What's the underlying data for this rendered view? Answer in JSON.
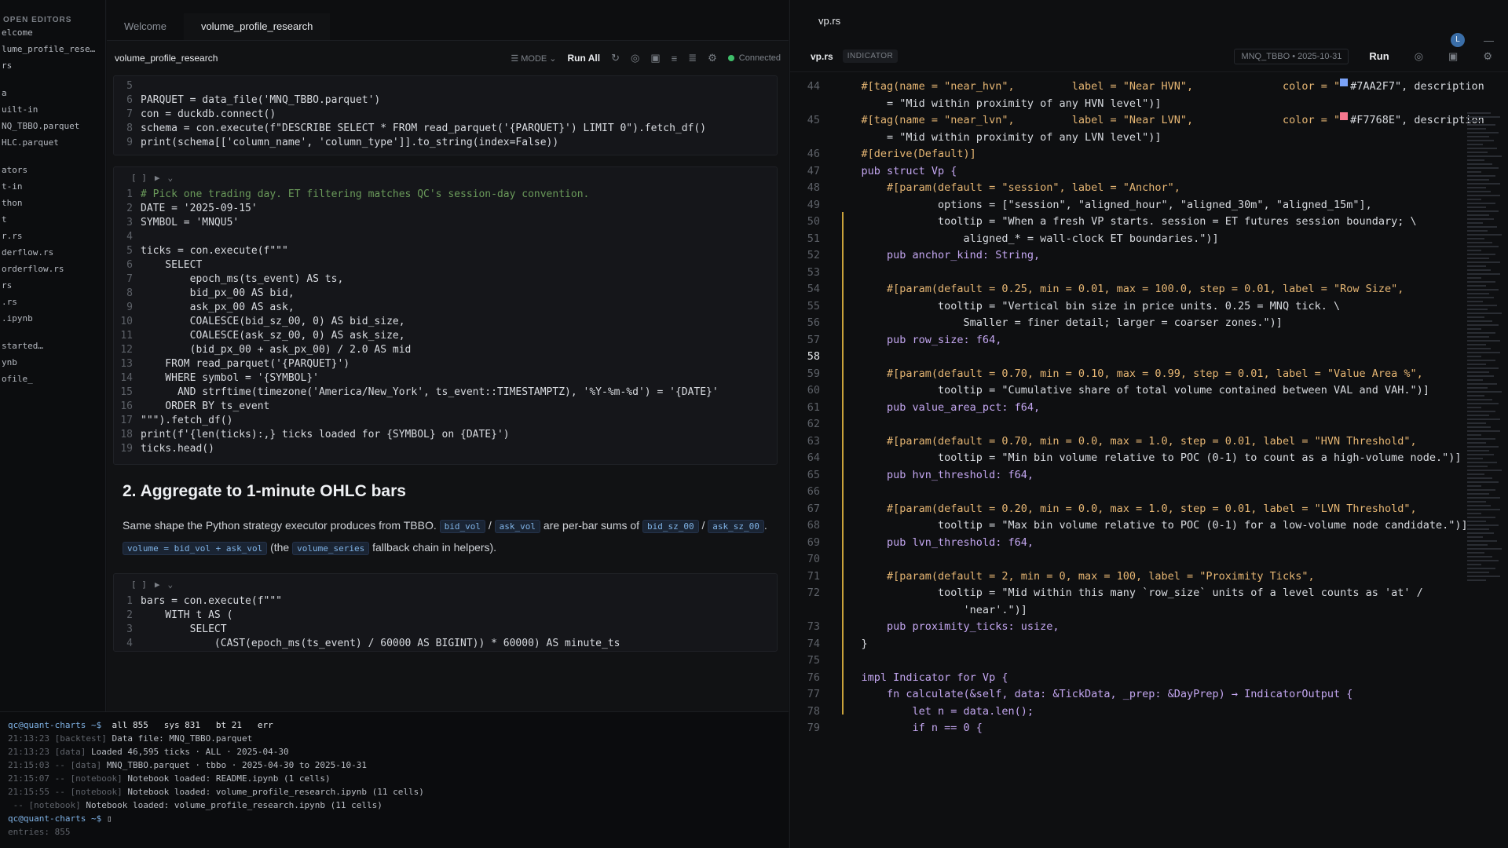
{
  "explorer": {
    "section": "OPEN EDITORS",
    "items": [
      "elcome",
      "lume_profile_rese…",
      "rs",
      "a",
      "uilt-in",
      "NQ_TBBO.parquet",
      "HLC.parquet",
      "ators",
      "t-in",
      "thon",
      "t",
      "r.rs",
      "derflow.rs",
      "orderflow.rs",
      "rs",
      ".rs",
      ".ipynb",
      "started…",
      "ynb",
      "ofile_"
    ]
  },
  "notebook": {
    "tabs": [
      "Welcome",
      "volume_profile_research"
    ],
    "title": "volume_profile_research",
    "mode_label": "MODE",
    "run_all": "Run All",
    "status": "Connected",
    "cell1_lines": [
      {
        "n": "5",
        "code": ""
      },
      {
        "n": "6",
        "code": "PARQUET = data_file('MNQ_TBBO.parquet')"
      },
      {
        "n": "7",
        "code": "con = duckdb.connect()"
      },
      {
        "n": "8",
        "code": "schema = con.execute(f\"DESCRIBE SELECT * FROM read_parquet('{PARQUET}') LIMIT 0\").fetch_df()"
      },
      {
        "n": "9",
        "code": "print(schema[['column_name', 'column_type']].to_string(index=False))"
      }
    ],
    "cell2_lines": [
      {
        "n": "1",
        "code": "# Pick one trading day. ET filtering matches QC's session-day convention."
      },
      {
        "n": "2",
        "code": "DATE = '2025-09-15'"
      },
      {
        "n": "3",
        "code": "SYMBOL = 'MNQU5'"
      },
      {
        "n": "4",
        "code": ""
      },
      {
        "n": "5",
        "code": "ticks = con.execute(f\"\"\""
      },
      {
        "n": "6",
        "code": "    SELECT"
      },
      {
        "n": "7",
        "code": "        epoch_ms(ts_event) AS ts,"
      },
      {
        "n": "8",
        "code": "        bid_px_00 AS bid,"
      },
      {
        "n": "9",
        "code": "        ask_px_00 AS ask,"
      },
      {
        "n": "10",
        "code": "        COALESCE(bid_sz_00, 0) AS bid_size,"
      },
      {
        "n": "11",
        "code": "        COALESCE(ask_sz_00, 0) AS ask_size,"
      },
      {
        "n": "12",
        "code": "        (bid_px_00 + ask_px_00) / 2.0 AS mid"
      },
      {
        "n": "13",
        "code": "    FROM read_parquet('{PARQUET}')"
      },
      {
        "n": "14",
        "code": "    WHERE symbol = '{SYMBOL}'"
      },
      {
        "n": "15",
        "code": "      AND strftime(timezone('America/New_York', ts_event::TIMESTAMPTZ), '%Y-%m-%d') = '{DATE}'"
      },
      {
        "n": "16",
        "code": "    ORDER BY ts_event"
      },
      {
        "n": "17",
        "code": "\"\"\").fetch_df()"
      },
      {
        "n": "18",
        "code": "print(f'{len(ticks):,} ticks loaded for {SYMBOL} on {DATE}')"
      },
      {
        "n": "19",
        "code": "ticks.head()"
      }
    ],
    "md_heading": "2. Aggregate to 1-minute OHLC bars",
    "md_text_1": "Same shape the Python strategy executor produces from TBBO.",
    "md_chip_1": "bid_vol",
    "md_sep_1": "/",
    "md_chip_2": "ask_vol",
    "md_text_2": "are per-bar sums of",
    "md_chip_3": "bid_sz_00",
    "md_sep_2": "/",
    "md_chip_4": "ask_sz_00",
    "md_sep_3": ".",
    "md_chip_5": "volume = bid_vol + ask_vol",
    "md_text_3": "(the",
    "md_chip_6": "volume_series",
    "md_text_4": "fallback chain in helpers).",
    "cell3_lines": [
      {
        "n": "1",
        "code": "bars = con.execute(f\"\"\""
      },
      {
        "n": "2",
        "code": "    WITH t AS ("
      },
      {
        "n": "3",
        "code": "        SELECT"
      },
      {
        "n": "4",
        "code": "            (CAST(epoch_ms(ts_event) / 60000 AS BIGINT)) * 60000) AS minute_ts"
      }
    ]
  },
  "terminal": {
    "prompt": "qc@quant-charts ~$",
    "counters": "all 855   sys 831   bt 21   err",
    "lines": [
      {
        "time": "21:13:23",
        "tag": "[backtest]",
        "text": "Data file: MNQ_TBBO.parquet"
      },
      {
        "time": "21:13:23",
        "tag": "[data]",
        "text": "Loaded 46,595 ticks · ALL · 2025-04-30"
      },
      {
        "time": "21:15:03",
        "tag": "-- [data]",
        "text": "MNQ_TBBO.parquet · tbbo · 2025-04-30 to 2025-10-31"
      },
      {
        "time": "21:15:07",
        "tag": "-- [notebook]",
        "text": "Notebook loaded: README.ipynb (1 cells)"
      },
      {
        "time": "21:15:55",
        "tag": "-- [notebook]",
        "text": "Notebook loaded: volume_profile_research.ipynb (11 cells)"
      },
      {
        "time": "",
        "tag": "-- [notebook]",
        "text": "Notebook loaded: volume_profile_research.ipynb (11 cells)"
      }
    ],
    "footer": "entries: 855"
  },
  "editor": {
    "file": "vp.rs",
    "tab": "vp.rs",
    "badge": "INDICATOR",
    "context": "MNQ_TBBO • 2025-10-31",
    "run": "Run",
    "avatar": "L",
    "active_line": "58",
    "lines": [
      {
        "n": "44",
        "code": "    #[tag(name = \"near_hvn\",         label = \"Near HVN\",              color = \"",
        "swatch": "#7AA2F7",
        "tail": "#7AA2F7\", description"
      },
      {
        "n": "",
        "code": "        = \"Mid within proximity of any HVN level\")]",
        "swatch": "",
        "tail": ""
      },
      {
        "n": "45",
        "code": "    #[tag(name = \"near_lvn\",         label = \"Near LVN\",              color = \"",
        "swatch": "#F7768E",
        "tail": "#F7768E\", description"
      },
      {
        "n": "",
        "code": "        = \"Mid within proximity of any LVN level\")]",
        "swatch": "",
        "tail": ""
      },
      {
        "n": "46",
        "code": "    #[derive(Default)]",
        "swatch": "",
        "tail": ""
      },
      {
        "n": "47",
        "code": "    pub struct Vp {",
        "swatch": "",
        "tail": ""
      },
      {
        "n": "48",
        "code": "        #[param(default = \"session\", label = \"Anchor\",",
        "swatch": "",
        "tail": ""
      },
      {
        "n": "49",
        "code": "                options = [\"session\", \"aligned_hour\", \"aligned_30m\", \"aligned_15m\"],",
        "swatch": "",
        "tail": ""
      },
      {
        "n": "50",
        "code": "                tooltip = \"When a fresh VP starts. session = ET futures session boundary; \\",
        "swatch": "",
        "tail": ""
      },
      {
        "n": "51",
        "code": "                    aligned_* = wall-clock ET boundaries.\")]",
        "swatch": "",
        "tail": ""
      },
      {
        "n": "52",
        "code": "        pub anchor_kind: String,",
        "swatch": "",
        "tail": ""
      },
      {
        "n": "53",
        "code": "",
        "swatch": "",
        "tail": ""
      },
      {
        "n": "54",
        "code": "        #[param(default = 0.25, min = 0.01, max = 100.0, step = 0.01, label = \"Row Size\",",
        "swatch": "",
        "tail": ""
      },
      {
        "n": "55",
        "code": "                tooltip = \"Vertical bin size in price units. 0.25 = MNQ tick. \\",
        "swatch": "",
        "tail": ""
      },
      {
        "n": "56",
        "code": "                    Smaller = finer detail; larger = coarser zones.\")]",
        "swatch": "",
        "tail": ""
      },
      {
        "n": "57",
        "code": "        pub row_size: f64,",
        "swatch": "",
        "tail": ""
      },
      {
        "n": "58",
        "code": "",
        "swatch": "",
        "tail": ""
      },
      {
        "n": "59",
        "code": "        #[param(default = 0.70, min = 0.10, max = 0.99, step = 0.01, label = \"Value Area %\",",
        "swatch": "",
        "tail": ""
      },
      {
        "n": "60",
        "code": "                tooltip = \"Cumulative share of total volume contained between VAL and VAH.\")]",
        "swatch": "",
        "tail": ""
      },
      {
        "n": "61",
        "code": "        pub value_area_pct: f64,",
        "swatch": "",
        "tail": ""
      },
      {
        "n": "62",
        "code": "",
        "swatch": "",
        "tail": ""
      },
      {
        "n": "63",
        "code": "        #[param(default = 0.70, min = 0.0, max = 1.0, step = 0.01, label = \"HVN Threshold\",",
        "swatch": "",
        "tail": ""
      },
      {
        "n": "64",
        "code": "                tooltip = \"Min bin volume relative to POC (0-1) to count as a high-volume node.\")]",
        "swatch": "",
        "tail": ""
      },
      {
        "n": "65",
        "code": "        pub hvn_threshold: f64,",
        "swatch": "",
        "tail": ""
      },
      {
        "n": "66",
        "code": "",
        "swatch": "",
        "tail": ""
      },
      {
        "n": "67",
        "code": "        #[param(default = 0.20, min = 0.0, max = 1.0, step = 0.01, label = \"LVN Threshold\",",
        "swatch": "",
        "tail": ""
      },
      {
        "n": "68",
        "code": "                tooltip = \"Max bin volume relative to POC (0-1) for a low-volume node candidate.\")]",
        "swatch": "",
        "tail": ""
      },
      {
        "n": "69",
        "code": "        pub lvn_threshold: f64,",
        "swatch": "",
        "tail": ""
      },
      {
        "n": "70",
        "code": "",
        "swatch": "",
        "tail": ""
      },
      {
        "n": "71",
        "code": "        #[param(default = 2, min = 0, max = 100, label = \"Proximity Ticks\",",
        "swatch": "",
        "tail": ""
      },
      {
        "n": "72",
        "code": "                tooltip = \"Mid within this many `row_size` units of a level counts as 'at' /",
        "swatch": "",
        "tail": ""
      },
      {
        "n": "",
        "code": "                    'near'.\")]",
        "swatch": "",
        "tail": ""
      },
      {
        "n": "73",
        "code": "        pub proximity_ticks: usize,",
        "swatch": "",
        "tail": ""
      },
      {
        "n": "74",
        "code": "    }",
        "swatch": "",
        "tail": ""
      },
      {
        "n": "75",
        "code": "",
        "swatch": "",
        "tail": ""
      },
      {
        "n": "76",
        "code": "    impl Indicator for Vp {",
        "swatch": "",
        "tail": ""
      },
      {
        "n": "77",
        "code": "        fn calculate(&self, data: &TickData, _prep: &DayPrep) → IndicatorOutput {",
        "swatch": "",
        "tail": ""
      },
      {
        "n": "78",
        "code": "            let n = data.len();",
        "swatch": "",
        "tail": ""
      },
      {
        "n": "79",
        "code": "            if n == 0 {",
        "swatch": "",
        "tail": ""
      }
    ]
  },
  "colors": {
    "accent_blue": "#7AA2F7",
    "accent_red": "#F7768E",
    "connected": "#3fbf6a",
    "guide": "#caa23b"
  }
}
